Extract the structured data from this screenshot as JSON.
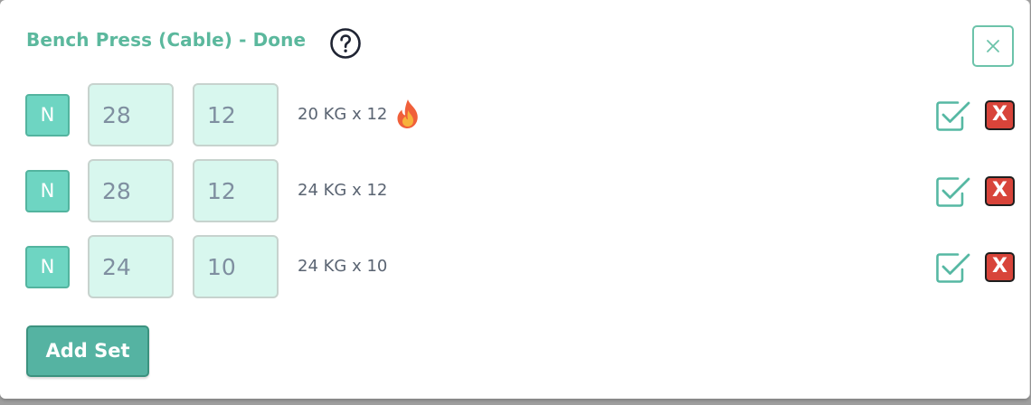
{
  "header": {
    "title": "Bench Press (Cable) - Done",
    "help_icon": "question-circle-icon",
    "close_icon": "close-icon"
  },
  "sets": [
    {
      "type": "N",
      "weight": "28",
      "reps": "12",
      "previous": "20 KG x 12",
      "personal_record": true
    },
    {
      "type": "N",
      "weight": "28",
      "reps": "12",
      "previous": "24 KG x 12",
      "personal_record": false
    },
    {
      "type": "N",
      "weight": "24",
      "reps": "10",
      "previous": "24 KG x 10",
      "personal_record": false
    }
  ],
  "row_actions": {
    "complete_icon": "checkbox-check-icon",
    "delete_label": "X"
  },
  "footer": {
    "add_set_label": "Add Set"
  },
  "colors": {
    "accent": "#5bb89d",
    "input_bg": "#d8f7ee",
    "set_type_bg": "#6ed5c2",
    "delete_bg": "#d8443a",
    "add_set_bg": "#55b3a2"
  }
}
